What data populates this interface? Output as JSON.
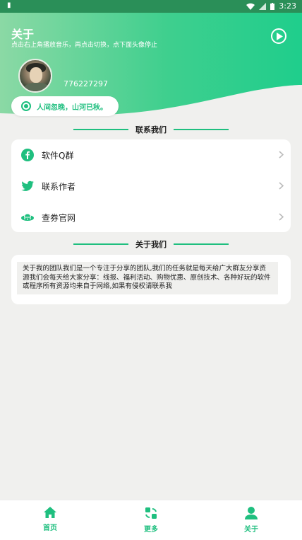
{
  "status_bar": {
    "time": "3:23"
  },
  "header": {
    "title": "关于",
    "subtitle": "点击右上角播放音乐，再点击切换，点下面头像停止",
    "qq_number": "776227297",
    "motto": "人间忽晚，山河已秋。"
  },
  "contact": {
    "section_title": "联系我们",
    "items": [
      {
        "label": "软件Q群",
        "icon": "facebook-icon"
      },
      {
        "label": "联系作者",
        "icon": "twitter-icon"
      },
      {
        "label": "查券官网",
        "icon": "ufo-icon"
      }
    ]
  },
  "about": {
    "section_title": "关于我们",
    "text": "关于我的团队我们是一个专注于分享的团队,我们的任务就是每天给广大群友分享资源我们会每天给大家分享：线报、福利活动、购物优惠、原创技术、各种好玩的软件或程序所有资源均来自于网络,如果有侵权请联系我"
  },
  "bottom_nav": {
    "items": [
      {
        "label": "首页",
        "icon": "home-icon"
      },
      {
        "label": "更多",
        "icon": "more-icon"
      },
      {
        "label": "关于",
        "icon": "user-icon"
      }
    ]
  },
  "colors": {
    "accent": "#1fbf7f",
    "header_start": "#8bd9a5",
    "header_end": "#1fce8c"
  }
}
